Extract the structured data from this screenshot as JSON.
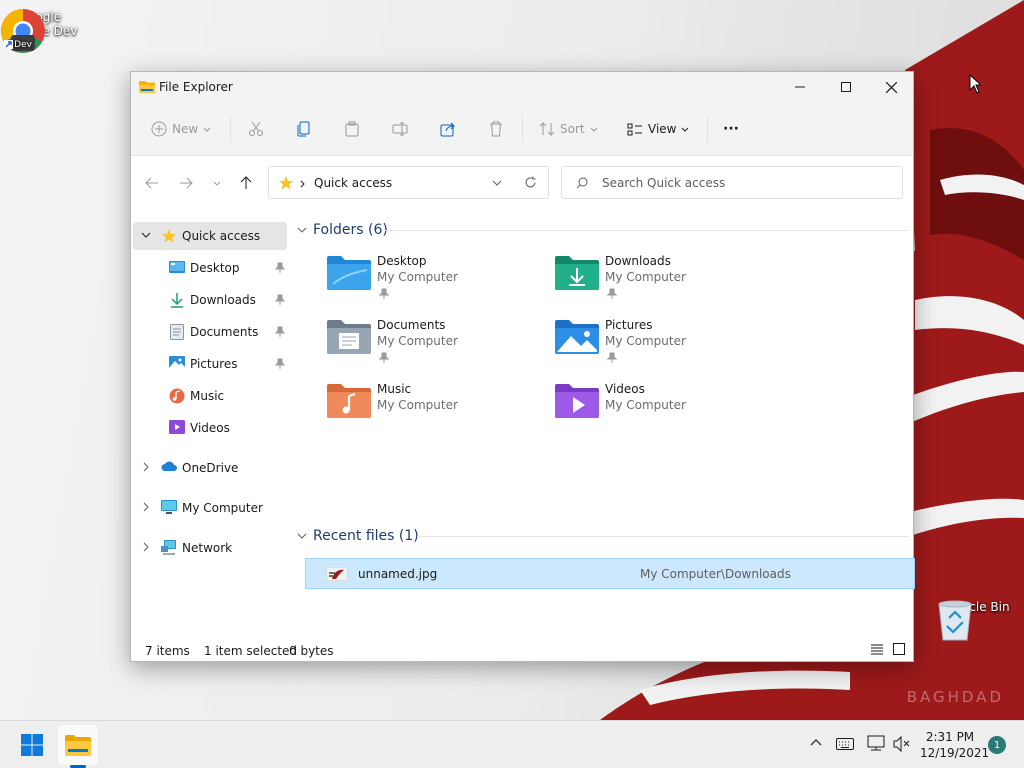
{
  "desktop": {
    "icons": [
      {
        "label": "Google Chrome Dev",
        "badge": "Dev",
        "icon": "chrome-dev-icon"
      },
      {
        "label": "Recycle Bin",
        "icon": "recycle-bin-icon"
      }
    ],
    "watermark": "BAGHDAD"
  },
  "window": {
    "title": "File Explorer",
    "controls": {
      "minimize": "minimize-icon",
      "maximize": "maximize-icon",
      "close": "close-icon"
    }
  },
  "commandbar": {
    "new_label": "New",
    "sort_label": "Sort",
    "view_label": "View",
    "more_label": "···"
  },
  "navigation": {
    "address_path": "Quick access",
    "search_placeholder": "Search Quick access"
  },
  "sidebar": {
    "quick_access": "Quick access",
    "pinned": [
      {
        "label": "Desktop",
        "pinned": true
      },
      {
        "label": "Downloads",
        "pinned": true
      },
      {
        "label": "Documents",
        "pinned": true
      },
      {
        "label": "Pictures",
        "pinned": true
      },
      {
        "label": "Music",
        "pinned": false
      },
      {
        "label": "Videos",
        "pinned": false
      }
    ],
    "roots": [
      {
        "label": "OneDrive"
      },
      {
        "label": "My Computer"
      },
      {
        "label": "Network"
      }
    ]
  },
  "content": {
    "folders_header": "Folders (6)",
    "folders": [
      {
        "name": "Desktop",
        "location": "My Computer",
        "pinned": true
      },
      {
        "name": "Downloads",
        "location": "My Computer",
        "pinned": true
      },
      {
        "name": "Documents",
        "location": "My Computer",
        "pinned": true
      },
      {
        "name": "Pictures",
        "location": "My Computer",
        "pinned": true
      },
      {
        "name": "Music",
        "location": "My Computer",
        "pinned": false
      },
      {
        "name": "Videos",
        "location": "My Computer",
        "pinned": false
      }
    ],
    "recent_header": "Recent files (1)",
    "recent_files": [
      {
        "name": "unnamed.jpg",
        "path": "My Computer\\Downloads",
        "selected": true
      }
    ]
  },
  "statusbar": {
    "item_count": "7 items",
    "selection": "1 item selected",
    "size": "0 bytes"
  },
  "taskbar": {
    "time": "2:31 PM",
    "date": "12/19/2021",
    "notification_count": "1"
  },
  "colors": {
    "accent": "#0067c0",
    "selection": "#cce8ff",
    "header_text": "#1e3c6e",
    "wallpaper_red": "#9e1a1a"
  }
}
